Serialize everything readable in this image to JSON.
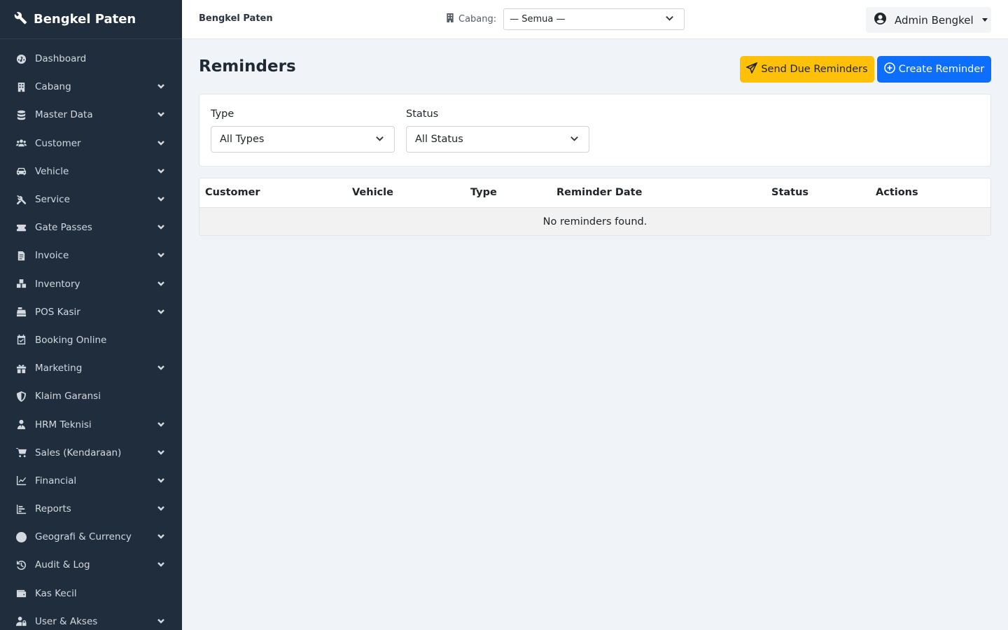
{
  "brand": {
    "name": "Bengkel Paten",
    "icon": "wrench-icon"
  },
  "sidebar": {
    "items": [
      {
        "label": "Dashboard",
        "icon": "gauge-icon",
        "has_children": false
      },
      {
        "label": "Cabang",
        "icon": "building-icon",
        "has_children": true
      },
      {
        "label": "Master Data",
        "icon": "database-icon",
        "has_children": true
      },
      {
        "label": "Customer",
        "icon": "users-icon",
        "has_children": true
      },
      {
        "label": "Vehicle",
        "icon": "car-icon",
        "has_children": true
      },
      {
        "label": "Service",
        "icon": "tools-icon",
        "has_children": true
      },
      {
        "label": "Gate Passes",
        "icon": "ticket-icon",
        "has_children": true
      },
      {
        "label": "Invoice",
        "icon": "invoice-icon",
        "has_children": true
      },
      {
        "label": "Inventory",
        "icon": "boxes-icon",
        "has_children": true
      },
      {
        "label": "POS Kasir",
        "icon": "cash-register-icon",
        "has_children": true
      },
      {
        "label": "Booking Online",
        "icon": "calendar-check-icon",
        "has_children": false
      },
      {
        "label": "Marketing",
        "icon": "gift-icon",
        "has_children": true
      },
      {
        "label": "Klaim Garansi",
        "icon": "shield-icon",
        "has_children": false
      },
      {
        "label": "HRM Teknisi",
        "icon": "user-tie-icon",
        "has_children": true
      },
      {
        "label": "Sales (Kendaraan)",
        "icon": "cart-icon",
        "has_children": true
      },
      {
        "label": "Financial",
        "icon": "chart-line-icon",
        "has_children": true
      },
      {
        "label": "Reports",
        "icon": "chart-bar-icon",
        "has_children": true
      },
      {
        "label": "Geografi & Currency",
        "icon": "globe-icon",
        "has_children": true
      },
      {
        "label": "Audit & Log",
        "icon": "history-icon",
        "has_children": true
      },
      {
        "label": "Kas Kecil",
        "icon": "wallet-icon",
        "has_children": false
      },
      {
        "label": "User & Akses",
        "icon": "user-lock-icon",
        "has_children": true
      }
    ]
  },
  "topbar": {
    "title": "Bengkel Paten",
    "branch_label": "Cabang:",
    "branch_value": "— Semua —",
    "user_name": "Admin Bengkel"
  },
  "main": {
    "title": "Reminders",
    "send_due_label": "Send Due Reminders",
    "create_label": "Create Reminder",
    "filters": {
      "type_label": "Type",
      "type_value": "All Types",
      "status_label": "Status",
      "status_value": "All Status"
    },
    "table": {
      "columns": [
        "Customer",
        "Vehicle",
        "Type",
        "Reminder Date",
        "Status",
        "Actions"
      ],
      "empty_message": "No reminders found."
    }
  },
  "colors": {
    "sidebar_bg": "#1f2d3d",
    "page_bg": "#f0f3f8",
    "warning": "#ffc107",
    "primary": "#0d6efd"
  }
}
